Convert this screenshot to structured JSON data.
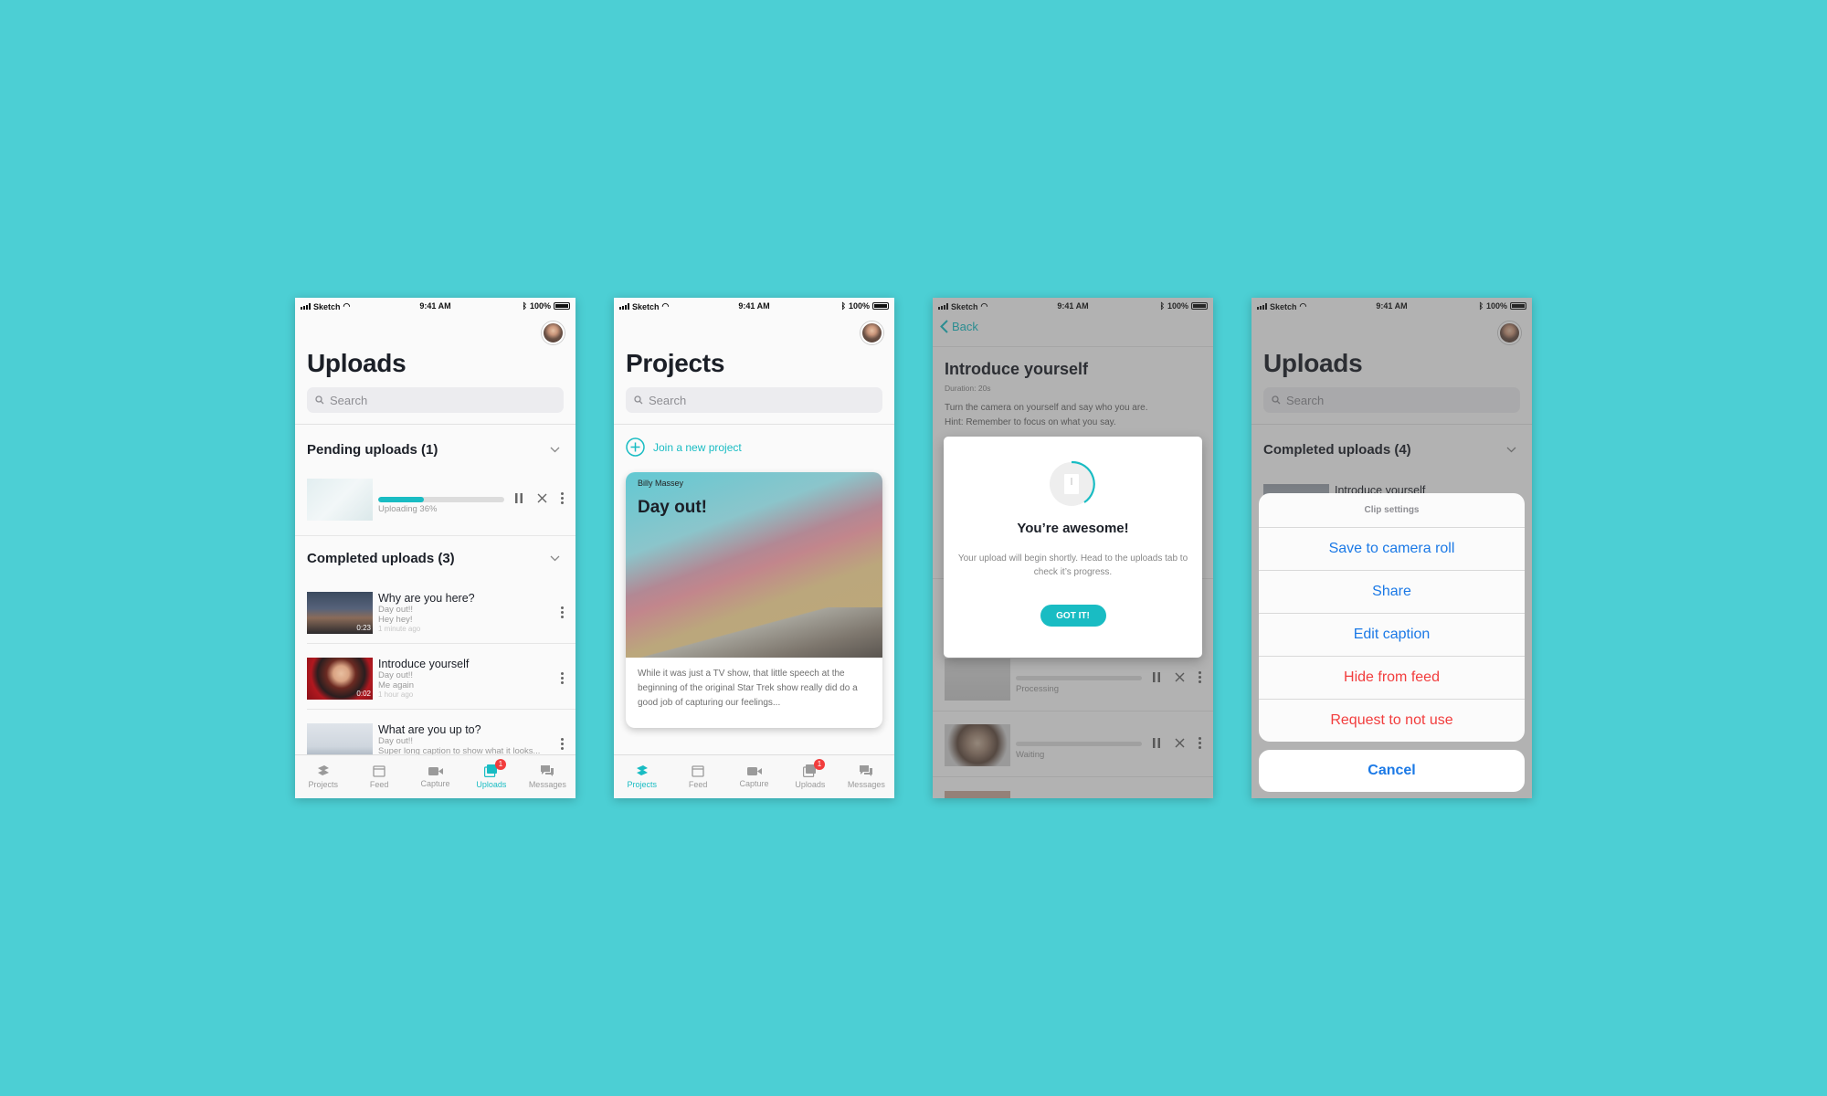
{
  "status": {
    "carrier": "Sketch",
    "time": "9:41 AM",
    "battery": "100%"
  },
  "colors": {
    "background": "#4ccfd4",
    "accent": "#19bcc3",
    "badge": "#f23d3d",
    "link": "#1b79e6"
  },
  "screen1": {
    "title": "Uploads",
    "search_placeholder": "Search",
    "pending_title": "Pending uploads (1)",
    "pending_item": {
      "status": "Uploading 36%",
      "progress": 0.36
    },
    "completed_title": "Completed uploads (3)",
    "items": [
      {
        "title": "Why are you here?",
        "project": "Day out!!",
        "caption": "Hey hey!",
        "time": "1 minute ago",
        "duration": "0:23"
      },
      {
        "title": "Introduce yourself",
        "project": "Day out!!",
        "caption": "Me again",
        "time": "1 hour ago",
        "duration": "0:02"
      },
      {
        "title": "What are you up to?",
        "project": "Day out!!",
        "caption": "Super long caption to show what it looks..."
      }
    ]
  },
  "tabs": [
    "Projects",
    "Feed",
    "Capture",
    "Uploads",
    "Messages"
  ],
  "tab_badge": "1",
  "screen2": {
    "title": "Projects",
    "search_placeholder": "Search",
    "join_label": "Join a  new project",
    "card": {
      "author": "Billy Massey",
      "title": "Day out!",
      "description": "While it was just a TV show, that little speech at the beginning of the original Star Trek show really did do a good job of capturing our feelings..."
    }
  },
  "screen3": {
    "back_label": "Back",
    "title": "Introduce yourself",
    "duration": "Duration: 20s",
    "instructions": "Turn the camera on yourself and say who you are.",
    "hint": "Hint: Remember to focus on what you say.",
    "modal": {
      "title": "You’re awesome!",
      "body": "Your upload will begin shortly. Head to the uploads tab to check it’s progress.",
      "button": "GOT IT!"
    },
    "rows": [
      {
        "status": "Processing"
      },
      {
        "status": "Waiting"
      }
    ]
  },
  "screen4": {
    "title": "Uploads",
    "search_placeholder": "Search",
    "completed_title": "Completed uploads (4)",
    "peek_item": "Introduce yourself",
    "sheet": {
      "header": "Clip settings",
      "options": [
        "Save to camera roll",
        "Share",
        "Edit caption"
      ],
      "destructive": [
        "Hide from feed",
        "Request to not use"
      ],
      "cancel": "Cancel"
    }
  }
}
